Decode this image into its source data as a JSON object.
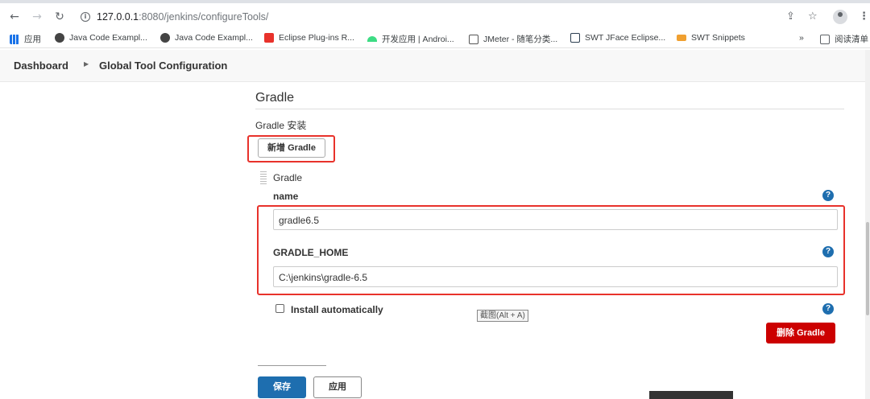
{
  "browser": {
    "url_host": "127.0.0.1",
    "url_path": ":8080/jenkins/configureTools/",
    "bookmarks": [
      {
        "label": "应用",
        "color": "#1a73e8"
      },
      {
        "label": "Java Code Exampl...",
        "color": "#444444"
      },
      {
        "label": "Java Code Exampl...",
        "color": "#444444"
      },
      {
        "label": "Eclipse Plug-ins R...",
        "color": "#e8322b"
      },
      {
        "label": "开发应用 | Androi...",
        "color": "#3ddc84"
      },
      {
        "label": "JMeter - 随笔分类...",
        "color": "#555555"
      },
      {
        "label": "SWT JFace Eclipse...",
        "color": "#2c3e50"
      },
      {
        "label": "SWT Snippets",
        "color": "#f0a030"
      }
    ],
    "more_label": "»",
    "reading_list": "阅读清单"
  },
  "breadcrumb": {
    "dashboard": "Dashboard",
    "separator": "›",
    "current": "Global Tool Configuration"
  },
  "gradle": {
    "section_title": "Gradle",
    "install_label": "Gradle 安装",
    "add_button": "新增 Gradle",
    "item_title": "Gradle",
    "name_label": "name",
    "name_value": "gradle6.5",
    "home_label": "GRADLE_HOME",
    "home_value": "C:\\jenkins\\gradle-6.5",
    "install_auto_label": "Install automatically",
    "delete_button": "删除 Gradle",
    "help": "?"
  },
  "tooltip": "截图(Alt + A)",
  "footer": {
    "save_button": "保存",
    "apply_button": "应用"
  },
  "colors": {
    "primary": "#1e6eaf",
    "danger": "#cc0000",
    "highlight": "#e8322b"
  }
}
